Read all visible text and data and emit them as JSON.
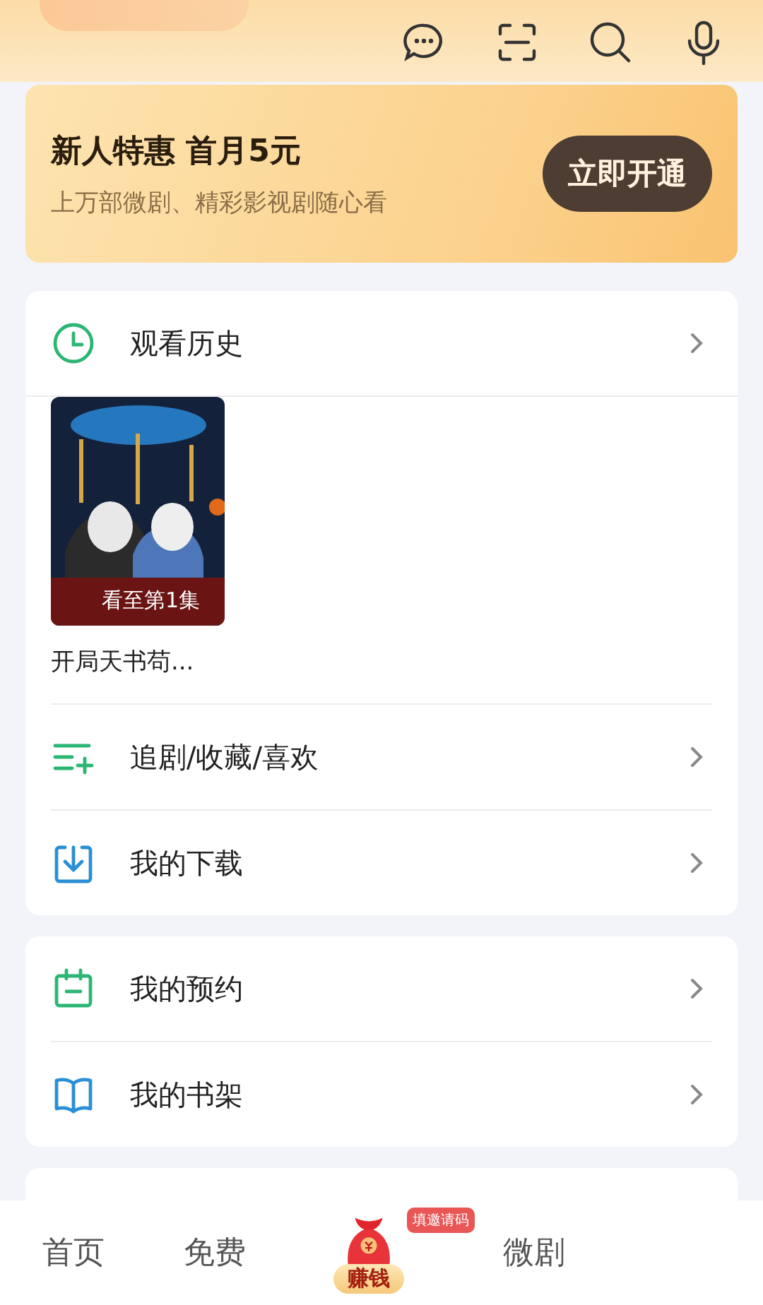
{
  "promo": {
    "title": "新人特惠 首月5元",
    "subtitle": "上万部微剧、精彩影视剧随心看",
    "button": "立即开通"
  },
  "sections": [
    {
      "rows": [
        {
          "kind": "history",
          "label": "观看历史",
          "items": [
            {
              "progress": "看至第1集",
              "title": "开局天书苟..."
            }
          ]
        },
        {
          "kind": "link",
          "label": "追剧/收藏/喜欢"
        },
        {
          "kind": "link",
          "label": "我的下载"
        }
      ]
    },
    {
      "rows": [
        {
          "kind": "link",
          "label": "我的预约"
        },
        {
          "kind": "link",
          "label": "我的书架"
        }
      ]
    }
  ],
  "nav": [
    {
      "kind": "text",
      "label": "首页"
    },
    {
      "kind": "text",
      "label": "免费"
    },
    {
      "kind": "special",
      "label": "赚钱",
      "badge": "填邀请码"
    },
    {
      "kind": "text",
      "label": "微剧"
    }
  ]
}
